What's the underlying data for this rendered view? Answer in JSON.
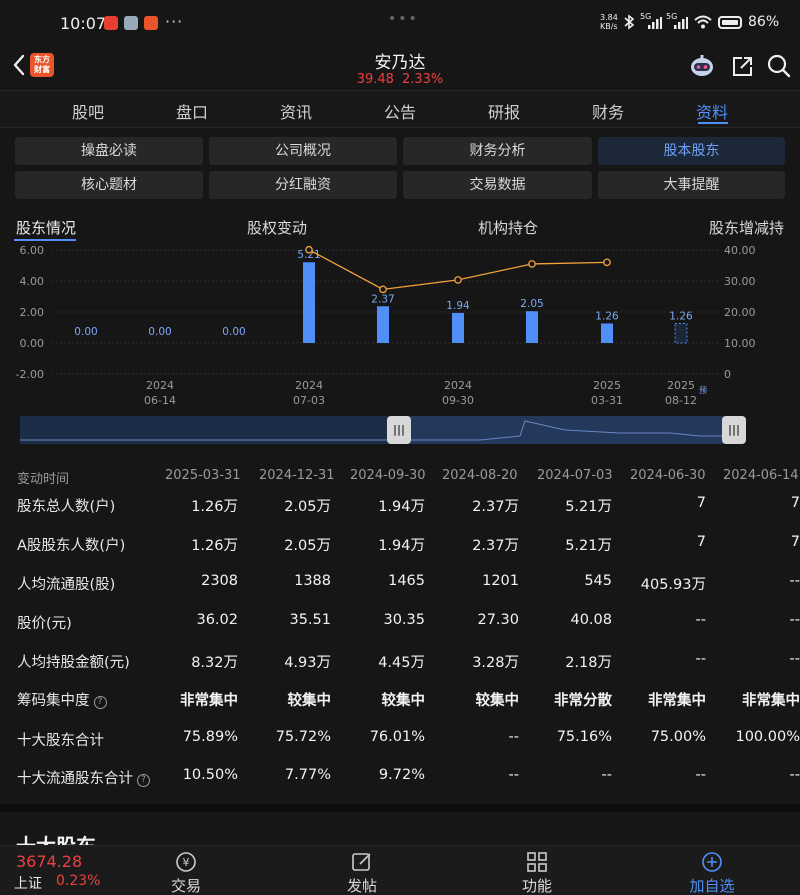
{
  "status_bar": {
    "time": "10:07",
    "dots": "···",
    "handle": "•••",
    "net_speed": "3.84\nKB/s",
    "signal_labels": [
      "5G",
      "5G"
    ],
    "battery": "86%"
  },
  "header": {
    "stock_name": "安乃达",
    "price": "39.48",
    "change_pct": "2.33%",
    "brand_logo": "东方\n财富",
    "icons": [
      "back-icon",
      "robot-avatar-icon",
      "share-icon",
      "search-icon"
    ]
  },
  "tabs": [
    "股吧",
    "盘口",
    "资讯",
    "公告",
    "研报",
    "财务",
    "资料"
  ],
  "active_tab": "资料",
  "buttons": [
    [
      "操盘必读",
      "公司概况",
      "财务分析",
      "股本股东"
    ],
    [
      "核心题材",
      "分红融资",
      "交易数据",
      "大事提醒"
    ]
  ],
  "active_button": "股本股东",
  "subtabs": [
    "股东情况",
    "股权变动",
    "机构持仓",
    "股东增减持"
  ],
  "chart_data": {
    "type": "bar",
    "categories": [
      "2024-06-14",
      "2024-06-30",
      "2024-07-03",
      "2024-08-20",
      "2024-09-30",
      "2024-12-31",
      "2025-03-31",
      "2025-08-12"
    ],
    "x_tick_labels": [
      {
        "year": "2024",
        "date": "06-14"
      },
      {
        "year": "2024",
        "date": "07-03"
      },
      {
        "year": "2024",
        "date": "09-30"
      },
      {
        "year": "2025",
        "date": "03-31"
      },
      {
        "year": "2025",
        "date": "08-12",
        "note": "预"
      }
    ],
    "series": [
      {
        "values": [
          0.0,
          0.0,
          5.21,
          2.37,
          1.94,
          2.05,
          1.26,
          1.26
        ],
        "labels": [
          "0.00",
          "0.00",
          "0.00",
          "5.21",
          "2.37",
          "1.94",
          "2.05",
          "1.26",
          "1.26"
        ],
        "axis": "left"
      },
      {
        "values": [
          null,
          null,
          40.08,
          27.3,
          30.35,
          35.51,
          36.02,
          null
        ],
        "axis": "right"
      }
    ],
    "bar_labels": [
      "0.00",
      "0.00",
      "0.00",
      "5.21",
      "2.37",
      "1.94",
      "2.05",
      "1.26",
      "1.26"
    ],
    "y_left_ticks": [
      "6.00",
      "4.00",
      "2.00",
      "0.00",
      "-2.00"
    ],
    "y_right_ticks": [
      "40.00",
      "30.00",
      "20.00",
      "10.00",
      "0"
    ],
    "ylim_left": [
      -2,
      6
    ],
    "ylim_right": [
      0,
      40
    ],
    "grid": true,
    "bar_color": "#4f8ff7",
    "line_color": "#f3a33a"
  },
  "table": {
    "header_label": "变动时间",
    "dates": [
      "2025-03-31",
      "2024-12-31",
      "2024-09-30",
      "2024-08-20",
      "2024-07-03",
      "2024-06-30",
      "2024-06-14"
    ],
    "rows": [
      {
        "label": "股东总人数(户)",
        "help": false,
        "values": [
          "1.26万",
          "2.05万",
          "1.94万",
          "2.37万",
          "5.21万",
          "7",
          "7"
        ]
      },
      {
        "label": "A股股东人数(户)",
        "help": false,
        "values": [
          "1.26万",
          "2.05万",
          "1.94万",
          "2.37万",
          "5.21万",
          "7",
          "7"
        ]
      },
      {
        "label": "人均流通股(股)",
        "help": false,
        "values": [
          "2308",
          "1388",
          "1465",
          "1201",
          "545",
          "405.93万",
          "--"
        ]
      },
      {
        "label": "股价(元)",
        "help": false,
        "values": [
          "36.02",
          "35.51",
          "30.35",
          "27.30",
          "40.08",
          "--",
          "--"
        ]
      },
      {
        "label": "人均持股金额(元)",
        "help": false,
        "values": [
          "8.32万",
          "4.93万",
          "4.45万",
          "3.28万",
          "2.18万",
          "--",
          "--"
        ]
      },
      {
        "label": "筹码集中度",
        "help": true,
        "values": [
          "非常集中",
          "较集中",
          "较集中",
          "较集中",
          "非常分散",
          "非常集中",
          "非常集中"
        ]
      },
      {
        "label": "十大股东合计",
        "help": false,
        "values": [
          "75.89%",
          "75.72%",
          "76.01%",
          "--",
          "75.16%",
          "75.00%",
          "100.00%"
        ]
      },
      {
        "label": "十大流通股东合计",
        "help": true,
        "values": [
          "10.50%",
          "7.77%",
          "9.72%",
          "--",
          "--",
          "--",
          "--"
        ]
      }
    ]
  },
  "section_title": "十大股东",
  "bottom": {
    "index_value": "3674.28",
    "index_name": "上证",
    "index_change": "0.23%",
    "nav": [
      "交易",
      "发帖",
      "功能",
      "加自选"
    ]
  },
  "colors": {
    "accent": "#4f8ff7",
    "up": "#ec4040",
    "bg": "#161616"
  }
}
